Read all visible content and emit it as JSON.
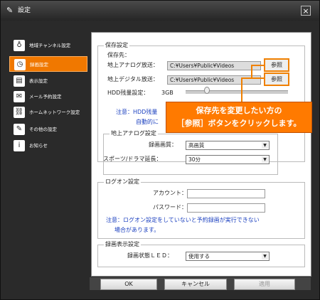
{
  "window": {
    "title": "設定",
    "close_icon": "×"
  },
  "sidebar": {
    "items": [
      {
        "label": "地域チャンネル設定",
        "icon": "satellite-icon",
        "glyph": "♁"
      },
      {
        "label": "録画設定",
        "icon": "clock-icon",
        "glyph": "◷",
        "active": true
      },
      {
        "label": "表示設定",
        "icon": "display-icon",
        "glyph": "▤"
      },
      {
        "label": "メール予約設定",
        "icon": "mail-icon",
        "glyph": "✉"
      },
      {
        "label": "ホームネットワーク設定",
        "icon": "network-icon",
        "glyph": "⛓"
      },
      {
        "label": "その他の設定",
        "icon": "wrench-icon",
        "glyph": "✎"
      },
      {
        "label": "お知らせ",
        "icon": "info-icon",
        "glyph": "i"
      }
    ]
  },
  "save": {
    "group_title": "保存設定",
    "dest_label": "保存先：",
    "analog_label": "地上アナログ放送：",
    "analog_path": "C:¥Users¥Public¥Videos",
    "digital_label": "地上デジタル放送：",
    "digital_path": "C:¥Users¥Public¥Videos",
    "ref_label": "参照",
    "hdd_label": "HDD残量設定：",
    "hdd_value": "3GB",
    "note_prefix": "注意：HDD残量",
    "note_line2": "自動的に"
  },
  "callout": {
    "line1": "保存先を変更したい方の",
    "line2": "［参照］ボタンをクリックします。"
  },
  "analog": {
    "group_title": "地上アナログ設定",
    "quality_label": "録画画質：",
    "quality_value": "高画質",
    "extend_label": "スポーツ/ドラマ延長：",
    "extend_value": "30分"
  },
  "logon": {
    "group_title": "ログオン設定",
    "account_label": "アカウント：",
    "account_value": "",
    "password_label": "パスワード：",
    "password_value": "",
    "note_line1": "注意：ログオン設定をしていないと予約録画が実行できない",
    "note_line2": "場合があります。"
  },
  "display": {
    "group_title": "録画表示設定",
    "led_label": "録画状態ＬＥＤ：",
    "led_value": "使用する"
  },
  "buttons": {
    "ok": "OK",
    "cancel": "キャンセル",
    "apply": "適用"
  },
  "colors": {
    "accent": "#f07800",
    "note": "#1a3fbf"
  }
}
